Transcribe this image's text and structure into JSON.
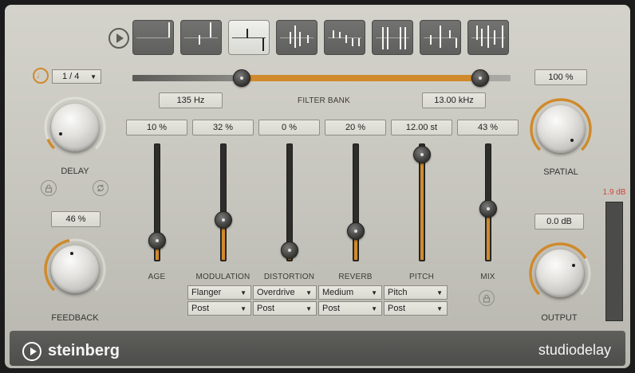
{
  "presets": {
    "play_icon": "play-icon",
    "items": [
      {
        "name": "preset-1",
        "active": false,
        "ticks": [
          [
            44,
            2,
            19
          ]
        ]
      },
      {
        "name": "preset-2",
        "active": false,
        "ticks": [
          [
            22,
            18,
            12
          ],
          [
            36,
            2,
            19
          ]
        ]
      },
      {
        "name": "preset-3",
        "active": true,
        "ticks": [
          [
            22,
            10,
            12
          ],
          [
            42,
            22,
            16
          ]
        ]
      },
      {
        "name": "preset-4",
        "active": false,
        "ticks": [
          [
            16,
            14,
            15
          ],
          [
            22,
            6,
            28
          ],
          [
            28,
            14,
            18
          ],
          [
            38,
            18,
            10
          ]
        ]
      },
      {
        "name": "preset-5",
        "active": false,
        "ticks": [
          [
            10,
            12,
            10
          ],
          [
            18,
            14,
            8
          ],
          [
            26,
            18,
            10
          ],
          [
            34,
            22,
            10
          ],
          [
            42,
            22,
            10
          ]
        ]
      },
      {
        "name": "preset-6",
        "active": false,
        "ticks": [
          [
            12,
            8,
            28
          ],
          [
            18,
            8,
            28
          ],
          [
            34,
            8,
            28
          ],
          [
            40,
            8,
            28
          ]
        ]
      },
      {
        "name": "preset-7",
        "active": false,
        "ticks": [
          [
            12,
            18,
            12
          ],
          [
            24,
            6,
            28
          ],
          [
            36,
            12,
            10
          ],
          [
            44,
            22,
            12
          ]
        ]
      },
      {
        "name": "preset-8",
        "active": false,
        "ticks": [
          [
            10,
            6,
            18
          ],
          [
            16,
            10,
            22
          ],
          [
            24,
            6,
            28
          ],
          [
            32,
            12,
            18
          ],
          [
            42,
            6,
            28
          ]
        ]
      }
    ]
  },
  "delay": {
    "sync_icon": "metronome-icon",
    "note_value": "1 / 4",
    "label": "DELAY",
    "knob_value": 0.08,
    "lock_icon": "lock-icon",
    "link_icon": "link-icon"
  },
  "feedback": {
    "value": "46 %",
    "label": "FEEDBACK",
    "knob_value": 0.46
  },
  "filter_bank": {
    "label": "FILTER BANK",
    "low_value": "135 Hz",
    "high_value": "13.00 kHz",
    "low_pos": 0.29,
    "high_pos": 0.92
  },
  "faders": [
    {
      "key": "age",
      "label": "AGE",
      "value": "10 %",
      "level": 0.1
    },
    {
      "key": "modulation",
      "label": "MODULATION",
      "value": "32 %",
      "level": 0.32
    },
    {
      "key": "distortion",
      "label": "DISTORTION",
      "value": "0 %",
      "level": 0.0
    },
    {
      "key": "reverb",
      "label": "REVERB",
      "value": "20 %",
      "level": 0.2
    },
    {
      "key": "pitch",
      "label": "PITCH",
      "value": "12.00 st",
      "level": 1.0
    },
    {
      "key": "mix",
      "label": "MIX",
      "value": "43 %",
      "level": 0.43
    }
  ],
  "effect_dropdowns": [
    {
      "type": "Flanger",
      "position": "Post"
    },
    {
      "type": "Overdrive",
      "position": "Post"
    },
    {
      "type": "Medium",
      "position": "Post"
    },
    {
      "type": "Pitch",
      "position": "Post"
    }
  ],
  "mix_lock_icon": "lock-icon",
  "spatial": {
    "value": "100 %",
    "label": "SPATIAL",
    "knob_value": 1.0
  },
  "output": {
    "value": "0.0 dB",
    "label": "OUTPUT",
    "knob_value": 0.72
  },
  "meter": {
    "peak": "1.9 dB"
  },
  "footer": {
    "brand": "steinberg",
    "product": "studiodelay"
  },
  "colors": {
    "accent": "#d08a2c",
    "panel": "#cbcac2",
    "meter_peak": "#d2443b"
  }
}
